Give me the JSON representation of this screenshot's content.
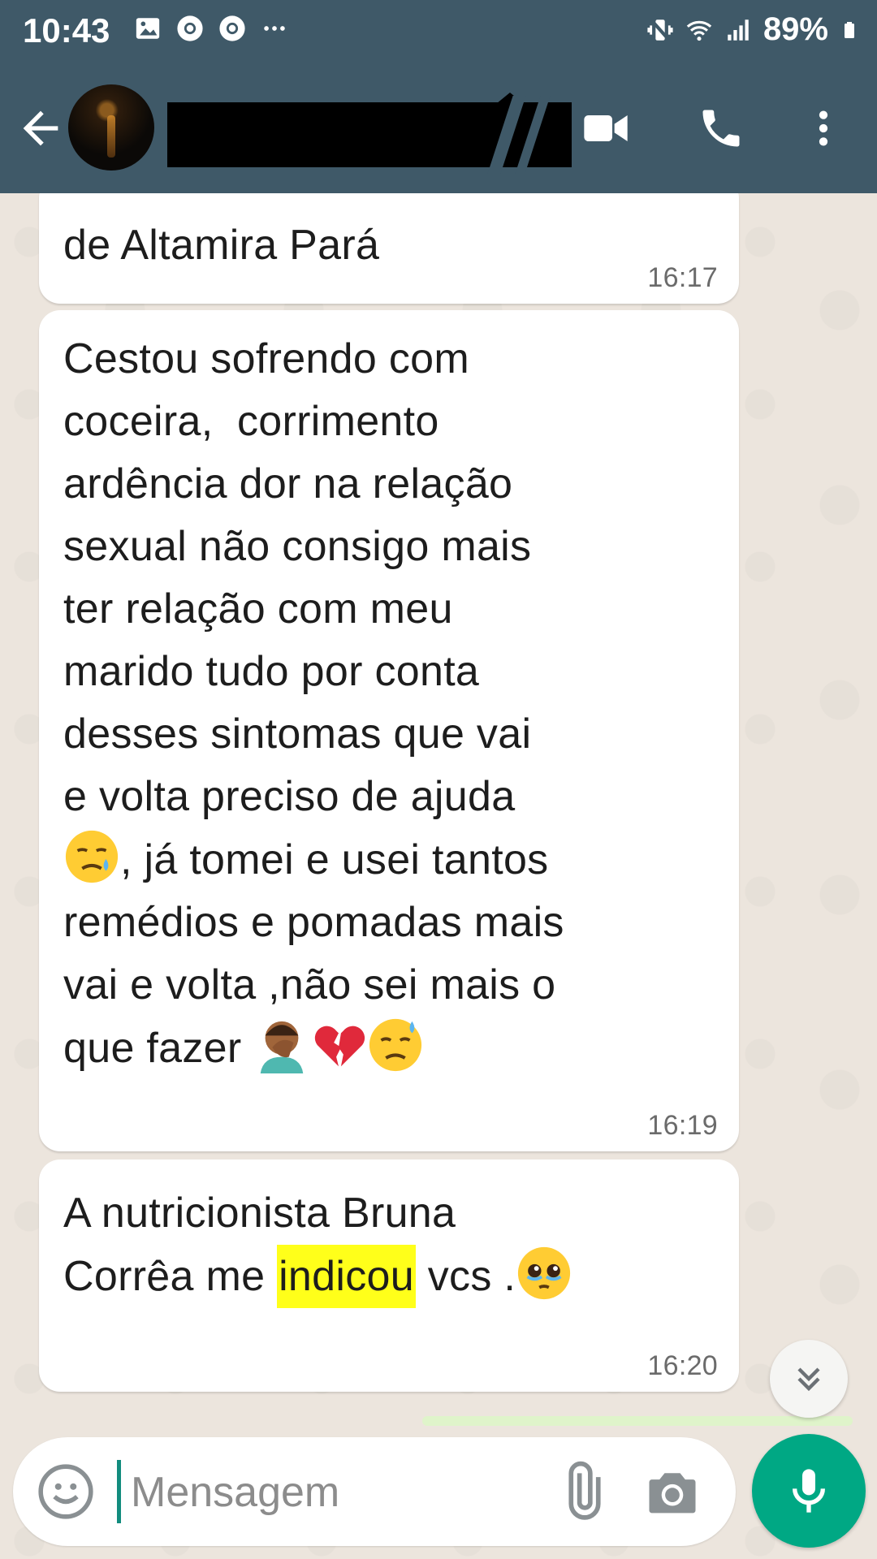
{
  "status_bar": {
    "time": "10:43",
    "battery": "89%",
    "icons": [
      "gallery-icon",
      "chrome-icon",
      "chrome-icon",
      "more-dots-icon",
      "vibrate-icon",
      "wifi-icon",
      "signal-icon",
      "battery-icon"
    ]
  },
  "header": {
    "contact_name_redacted": true,
    "actions": [
      "video-call-icon",
      "phone-icon",
      "more-vert-icon"
    ]
  },
  "messages": [
    {
      "text_visible": "de Altamira Pará",
      "time": "16:17"
    },
    {
      "text": "Cestou sofrendo com\ncoceira,  corrimento\nardência dor na relação\nsexual não consigo mais\nter relação com meu\nmarido tudo por conta\ndesses sintomas que vai\ne volta preciso de ajuda",
      "line_emoji_after": ", já tomei e usei tantos",
      "text_after": "remédios e pomadas mais\nvai e volta ,não sei mais o",
      "last_line": "que fazer ",
      "time": "16:19"
    },
    {
      "line1": "A nutricionista Bruna",
      "line2_before": "Corrêa me ",
      "line2_highlight": "indicou",
      "line2_after": " vcs .",
      "time": "16:20"
    }
  ],
  "input": {
    "placeholder": "Mensagem"
  },
  "colors": {
    "header": "#3f5968",
    "chat_bg": "#ece5dd",
    "bubble": "#ffffff",
    "highlight": "#ffff1a",
    "accent": "#00a884"
  }
}
